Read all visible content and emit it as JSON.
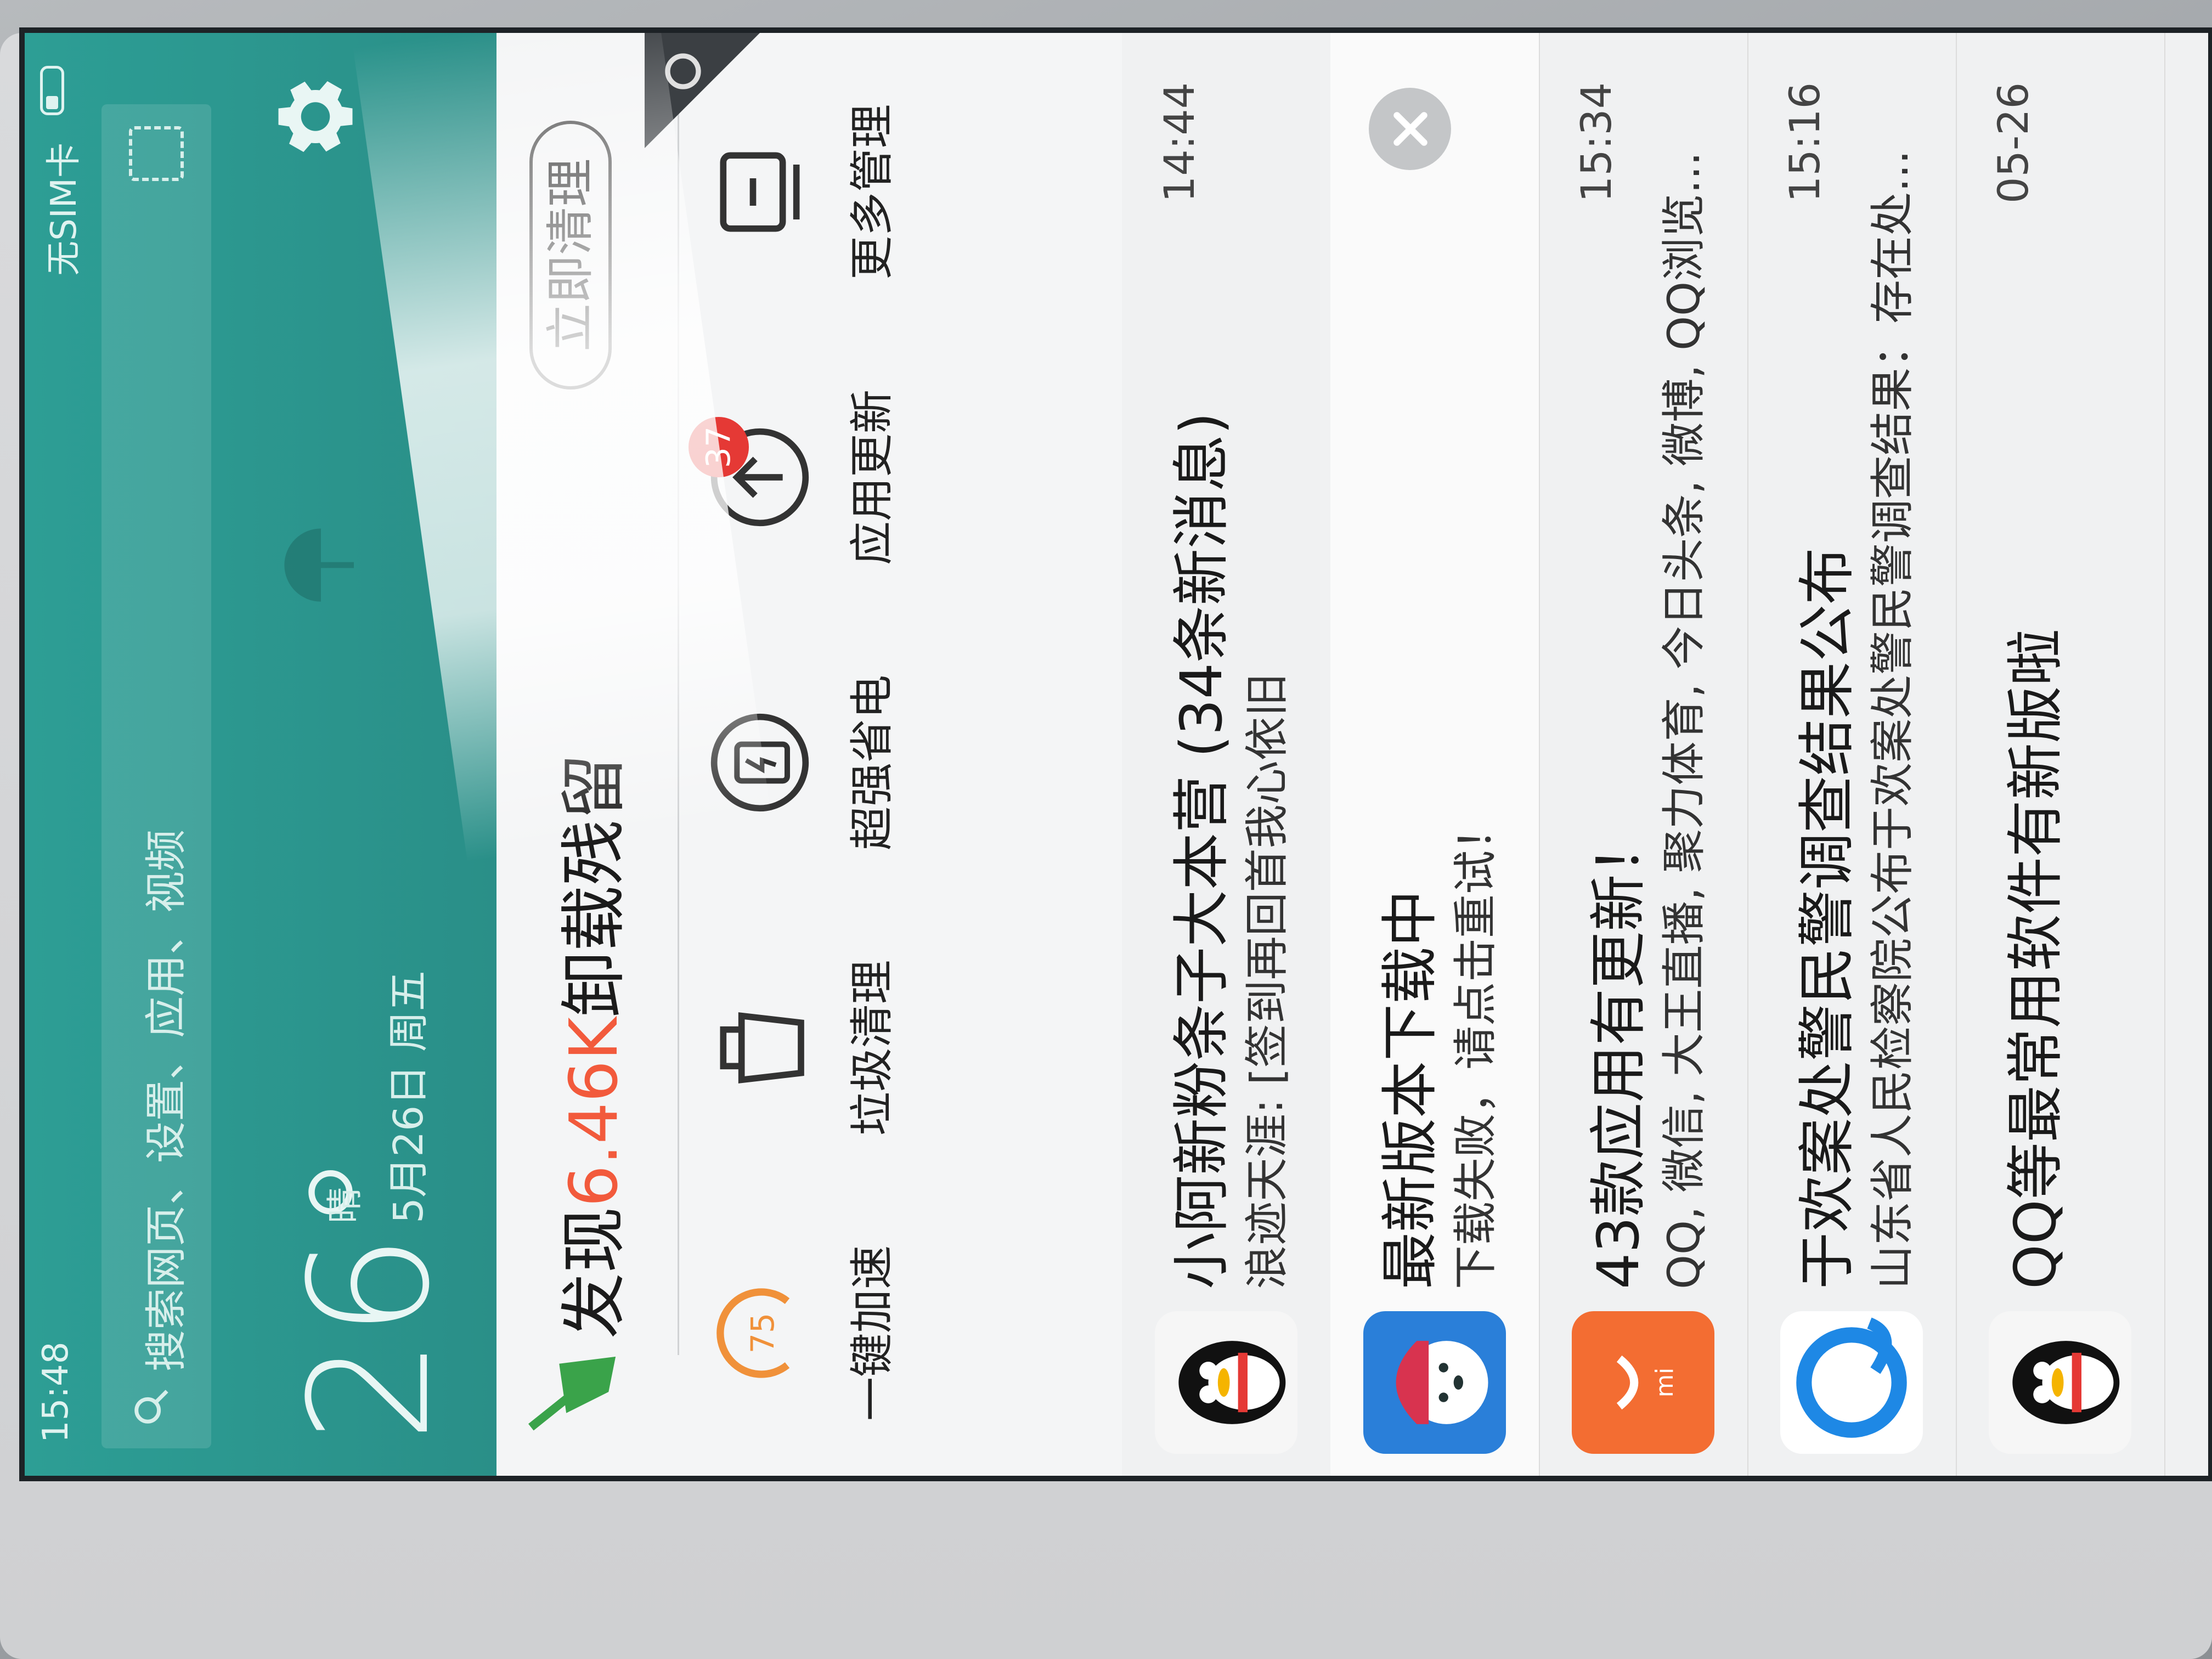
{
  "status": {
    "time": "15:48",
    "sim": "无SIM卡"
  },
  "search": {
    "placeholder": "搜索网页、设置、应用、视频"
  },
  "weather": {
    "temp": "26°",
    "condition": "晴",
    "date": "5月26日 周五"
  },
  "cleaner": {
    "title_prefix": "发现",
    "title_highlight": "6.46K",
    "title_suffix": "卸载残留",
    "clean_button": "立即清理",
    "boost_value": "75",
    "tools": [
      {
        "label": "一键加速"
      },
      {
        "label": "垃圾清理"
      },
      {
        "label": "超强省电"
      },
      {
        "label": "应用更新",
        "badge": "37"
      },
      {
        "label": "更多管理"
      }
    ]
  },
  "notifications": [
    {
      "title": "小阿新粉条子大本营 (34条新消息)",
      "subtitle": "浪迹天涯: [签到再回首我心依旧",
      "time": "14:44"
    },
    {
      "title": "最新版本下载中",
      "subtitle": "下载失败，请点击重试！",
      "time": ""
    },
    {
      "title": "43款应用有更新！",
      "subtitle": "QQ, 微信, 大王直播, 聚力体育, 今日头条, 微博, QQ浏览...",
      "time": "15:34"
    },
    {
      "title": "于欢案处警民警调查结果公布",
      "subtitle": "山东省人民检察院公布于欢案处警民警调查结果：存在处...",
      "time": "15:16"
    },
    {
      "title": "QQ等最常用软件有新版啦",
      "subtitle": "",
      "time": "05-26"
    }
  ],
  "colors": {
    "header": "#2d9e95",
    "accent": "#f25a3c",
    "badge": "#e53935"
  }
}
